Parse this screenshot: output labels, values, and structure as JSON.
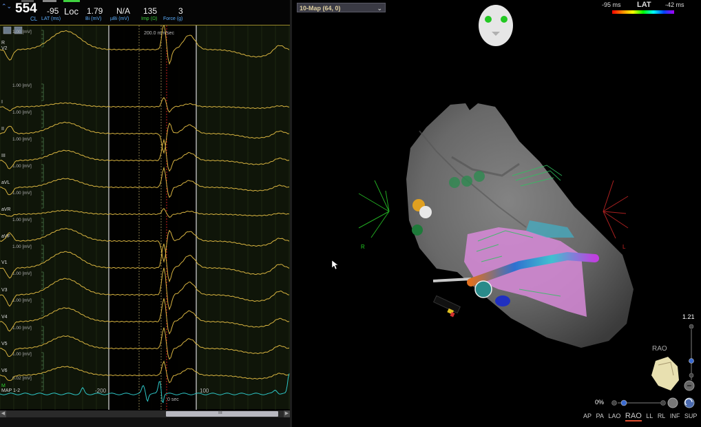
{
  "header": {
    "cl_value": "554",
    "cl_label": "CL",
    "cl_arrows": "⌃⌄",
    "lat_value": "-95",
    "lat_label": "LAT (ms)",
    "loc_label": "Loc",
    "bi_value": "1.79",
    "bi_label": "Bi (mV)",
    "ubi_value": "N/A",
    "ubi_label": "µBi (mV)",
    "imp_value": "135",
    "imp_label": "Imp (Ω)",
    "force_value": "3",
    "force_label": "Force (g)"
  },
  "ecg": {
    "speed_label": "200.0 mm/sec",
    "scale_label": "1.00 [mV]",
    "leads": [
      "V2",
      "I",
      "II",
      "III",
      "aVL",
      "aVR",
      "aVF",
      "V1",
      "V3",
      "V4",
      "V5",
      "V6",
      "MAP 1-2"
    ],
    "top_marker": "R",
    "map_marker": "M",
    "map_scale_label": "0.02 [mV]",
    "timeline_labels": [
      "-200",
      "0 sec",
      "100"
    ],
    "scroll_mid": "III",
    "colors": {
      "trace": "#d8b440",
      "map_trace": "#2ec8c8",
      "grid": "#2a3a1a",
      "marker": "#cc2020"
    }
  },
  "map": {
    "selector_label": "10-Map (64, 0)",
    "lat_scale": {
      "title": "LAT",
      "low": "-95 ms",
      "high": "-42 ms"
    },
    "orientation_left_label": "R",
    "orientation_right_label": "L",
    "zoom_value": "1.21",
    "view_label": "RAO",
    "transparency_pct": "0%",
    "view_tabs": [
      "AP",
      "PA",
      "LAO",
      "RAO",
      "LL",
      "RL",
      "INF",
      "SUP"
    ],
    "active_view": "RAO",
    "icons": [
      "face-orientation-icon",
      "heart-thumbnail-icon",
      "cursor-pointer-icon"
    ]
  }
}
